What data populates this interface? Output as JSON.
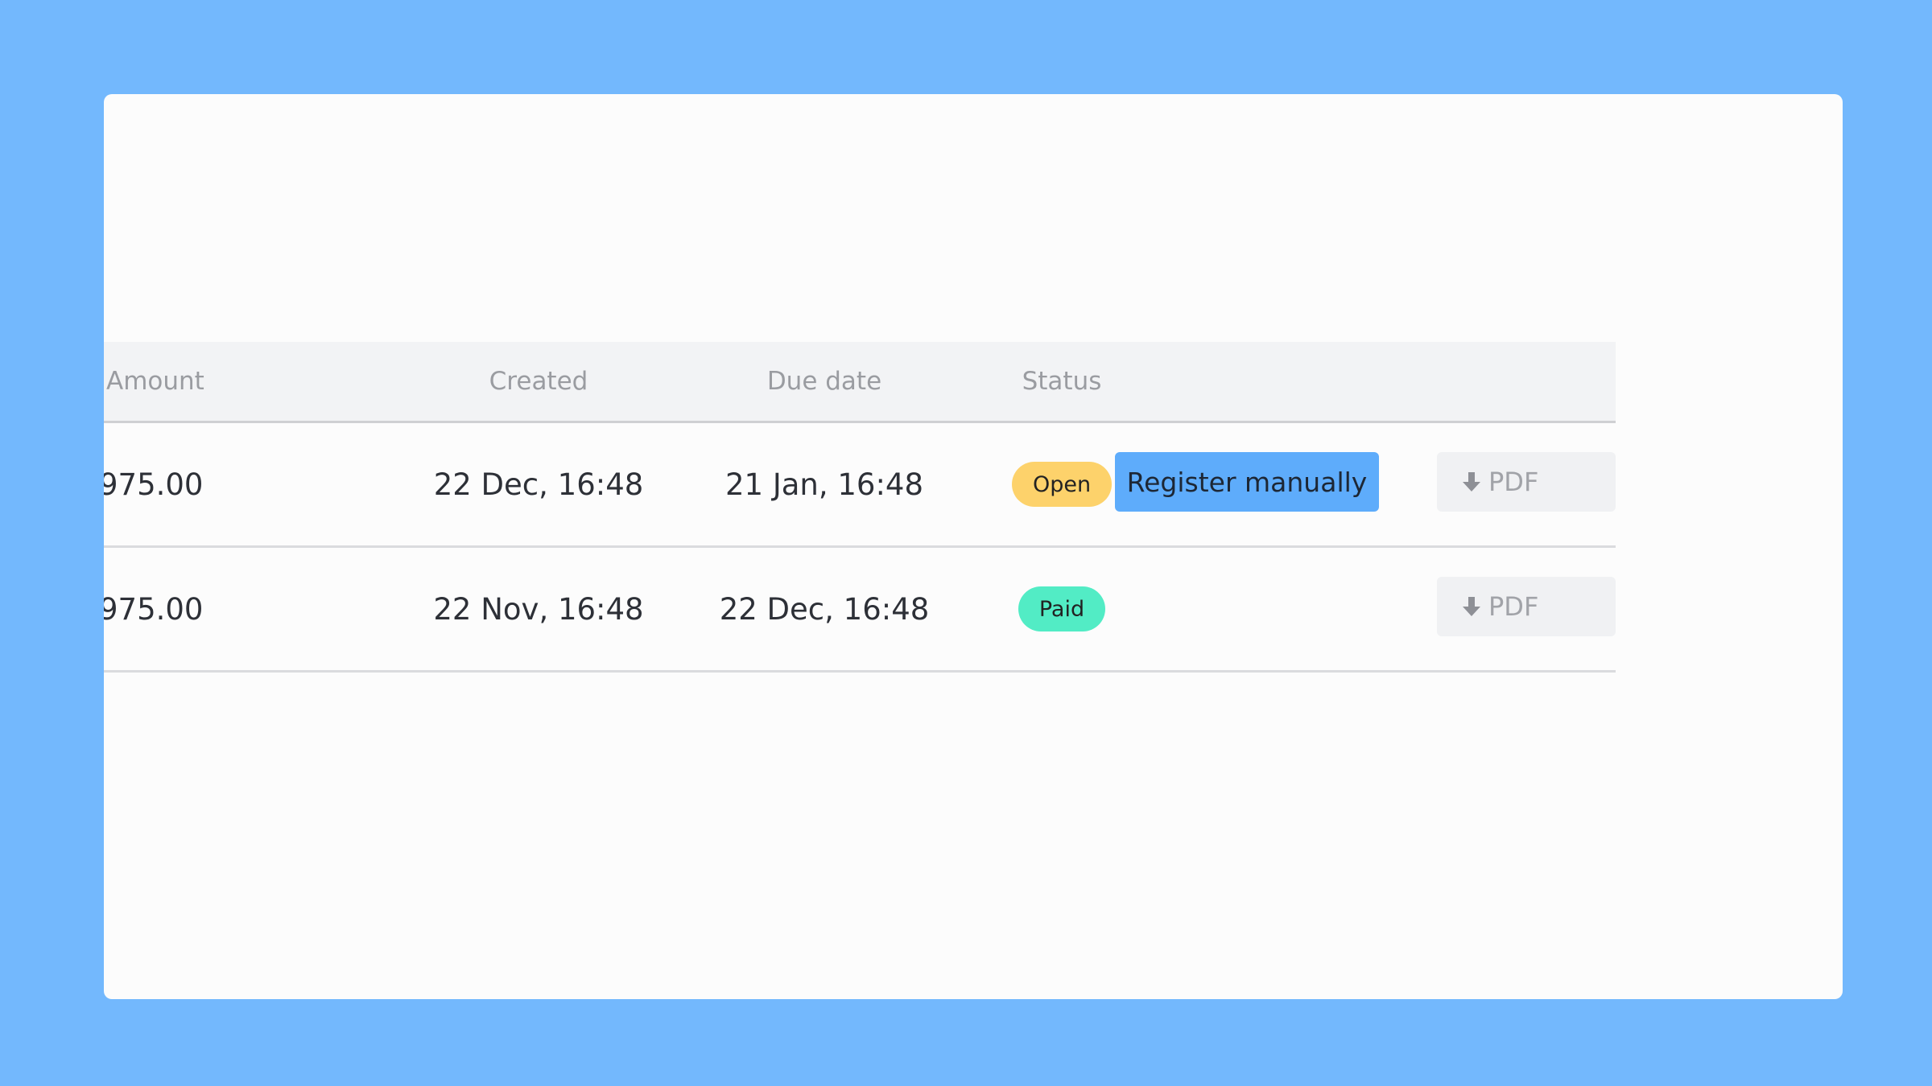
{
  "table": {
    "headers": {
      "amount": "Amount",
      "created": "Created",
      "due_date": "Due date",
      "status": "Status"
    },
    "rows": [
      {
        "amount": "975.00",
        "created": "22 Dec, 16:48",
        "due_date": "21 Jan, 16:48",
        "status": "Open",
        "status_color": "#fdd26b",
        "action_label": "Register manually",
        "pdf_label": "PDF",
        "pdf_icon": "download-arrow-icon"
      },
      {
        "amount": "975.00",
        "created": "22 Nov, 16:48",
        "due_date": "22 Dec, 16:48",
        "status": "Paid",
        "status_color": "#52ecc5",
        "pdf_label": "PDF",
        "pdf_icon": "download-arrow-icon"
      }
    ]
  },
  "colors": {
    "background": "#73b8fd",
    "card": "#fcfcfc",
    "header_bg": "#f2f3f5",
    "primary_button": "#5eacfb",
    "pdf_button": "#f0f1f3"
  }
}
